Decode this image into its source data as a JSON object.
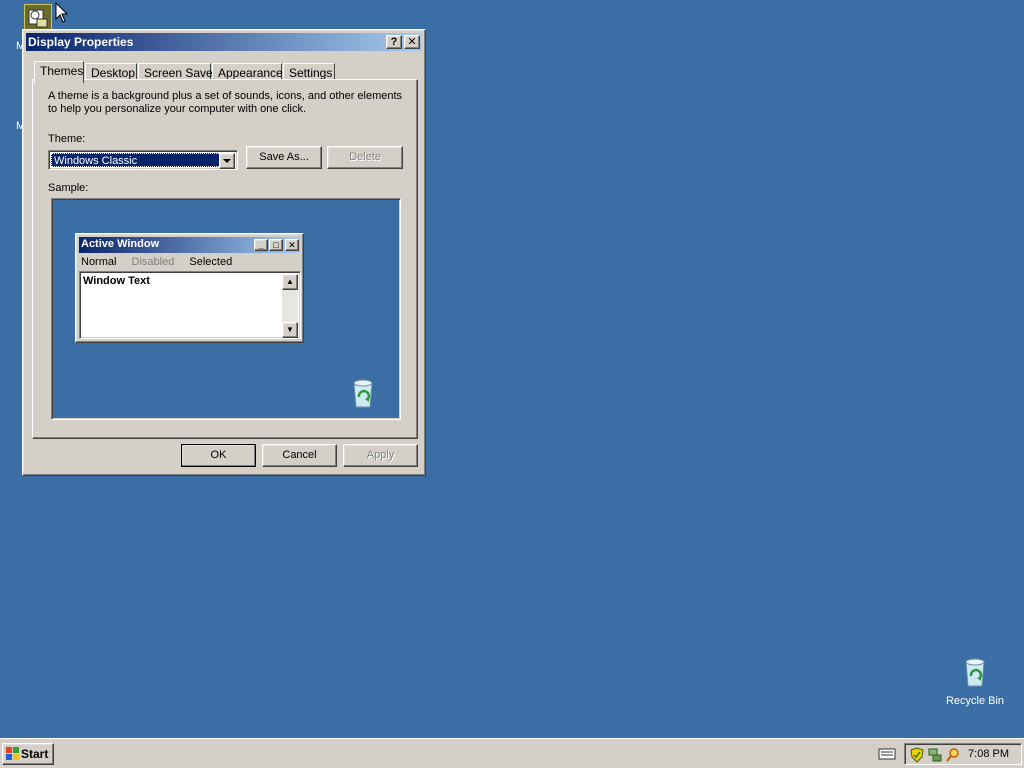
{
  "window": {
    "title": "Display Properties",
    "help_btn": "?",
    "close_btn": "✕"
  },
  "tabs": [
    "Themes",
    "Desktop",
    "Screen Saver",
    "Appearance",
    "Settings"
  ],
  "themes": {
    "description": "A theme is a background plus a set of sounds, icons, and other elements to help you personalize your computer with one click.",
    "theme_label": "Theme:",
    "theme_value": "Windows Classic",
    "save_as": "Save As...",
    "delete": "Delete",
    "sample_label": "Sample:"
  },
  "sample": {
    "window_title": "Active Window",
    "menu": [
      "Normal",
      "Disabled",
      "Selected"
    ],
    "window_text": "Window Text"
  },
  "buttons": {
    "ok": "OK",
    "cancel": "Cancel",
    "apply": "Apply"
  },
  "desktop": {
    "recycle_bin": "Recycle Bin",
    "partial_labels": [
      "M",
      "M"
    ]
  },
  "taskbar": {
    "start": "Start",
    "clock": "7:08 PM"
  },
  "icons": [
    "display-icon",
    "recycle-bin-icon",
    "keyboard-icon",
    "shield-icon",
    "network-icon",
    "search-icon",
    "windows-logo-icon"
  ],
  "colors": {
    "desktop": "#3a6ea5",
    "title_active": "#0a246a",
    "face": "#d4d0c8"
  }
}
